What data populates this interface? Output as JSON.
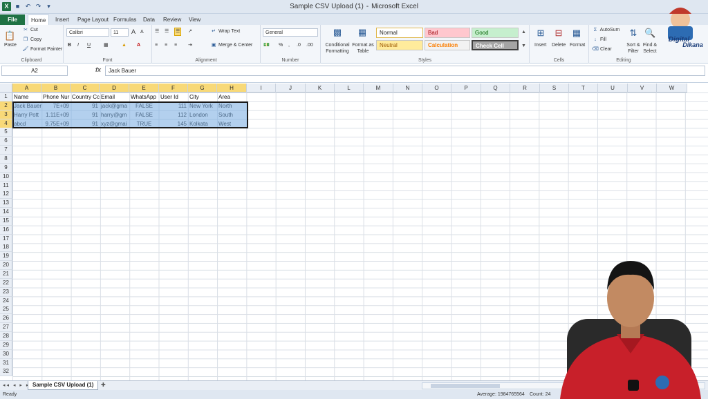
{
  "window": {
    "title": "Sample CSV Upload (1)",
    "separator": "-",
    "app": "Microsoft Excel"
  },
  "qat": {
    "excel_glyph": "X",
    "save_glyph": "■",
    "undo_glyph": "↶",
    "redo_glyph": "↷",
    "more_glyph": "▾"
  },
  "tabs": [
    "File",
    "Home",
    "Insert",
    "Page Layout",
    "Formulas",
    "Data",
    "Review",
    "View"
  ],
  "ribbon": {
    "clipboard": {
      "label": "Clipboard",
      "paste": "Paste",
      "cut": "Cut",
      "copy": "Copy",
      "format_painter": "Format Painter"
    },
    "font": {
      "label": "Font",
      "name": "Calibri",
      "size": "11",
      "bold": "B",
      "italic": "I",
      "underline": "U",
      "grow": "A",
      "shrink": "A"
    },
    "alignment": {
      "label": "Alignment",
      "wrap": "Wrap Text",
      "merge": "Merge & Center"
    },
    "number": {
      "label": "Number",
      "format": "General",
      "percent": "%",
      "comma": ",",
      "inc_dec": ".0",
      "dec_dec": ".00"
    },
    "styles": {
      "label": "Styles",
      "conditional": "Conditional Formatting",
      "format_table": "Format as Table",
      "normal": "Normal",
      "bad": "Bad",
      "good": "Good",
      "neutral": "Neutral",
      "calculation": "Calculation",
      "check_cell": "Check Cell"
    },
    "cells": {
      "label": "Cells",
      "insert": "Insert",
      "delete": "Delete",
      "format": "Format"
    },
    "editing": {
      "label": "Editing",
      "autosum": "AutoSum",
      "fill": "Fill",
      "clear": "Clear",
      "sort": "Sort & Filter",
      "find": "Find & Select"
    }
  },
  "formula_bar": {
    "name_box": "A2",
    "fx": "fx",
    "value": "Jack Bauer"
  },
  "columns": [
    "A",
    "B",
    "C",
    "D",
    "E",
    "F",
    "G",
    "H",
    "I",
    "J",
    "K",
    "L",
    "M",
    "N",
    "O",
    "P",
    "Q",
    "R",
    "S",
    "T",
    "U",
    "V",
    "W"
  ],
  "rows": [
    "1",
    "2",
    "3",
    "4",
    "5",
    "6",
    "7",
    "8",
    "9",
    "10",
    "11",
    "12",
    "13",
    "14",
    "15",
    "16",
    "17",
    "18",
    "19",
    "20",
    "21",
    "22",
    "23",
    "24",
    "25",
    "26",
    "27",
    "28",
    "29",
    "30",
    "31",
    "32"
  ],
  "table": {
    "header": [
      "Name",
      "Phone Nur",
      "Country Cc",
      "Email",
      "WhatsApp",
      "User Id",
      "City",
      "Area"
    ],
    "rows": [
      [
        "Jack Bauer",
        "7E+09",
        "91",
        "jack@gma",
        "FALSE",
        "111",
        "New York",
        "North"
      ],
      [
        "Harry Pott",
        "1.11E+09",
        "91",
        "harry@gm",
        "FALSE",
        "112",
        "London",
        "South"
      ],
      [
        "abcd",
        "9.75E+09",
        "91",
        "xyz@gmai",
        "TRUE",
        "145",
        "Kolkata",
        "West"
      ]
    ]
  },
  "sheet": {
    "name": "Sample CSV Upload (1)",
    "nav": "◂◂ ◂ ▸ ▸▸"
  },
  "status": {
    "ready": "Ready",
    "average": "Average: 1984765564",
    "count": "Count: 24"
  },
  "logo": {
    "line1": "Digital",
    "line2": "Dikana"
  },
  "colors": {
    "accent": "#1f7244",
    "selection": "#74aae0",
    "header_sel": "#f8d978",
    "shirt": "#c8202a"
  }
}
